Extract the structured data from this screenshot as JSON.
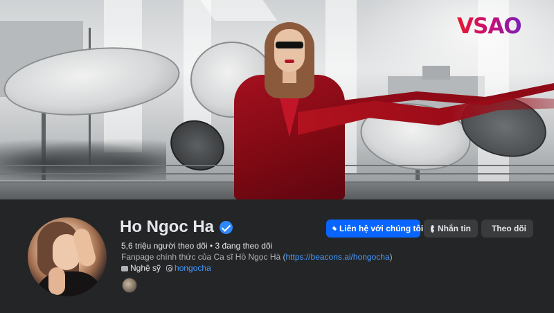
{
  "cover": {
    "brand_logo_text": "VSAO"
  },
  "profile": {
    "name": "Ho Ngoc Ha",
    "followers": "5,6 triệu người theo dõi",
    "following": "3 đang theo dõi",
    "bio_prefix": "Fanpage chính thức của Ca sĩ Hồ Ngọc Hà (",
    "bio_link": "https://beacons.ai/hongocha",
    "bio_suffix": ")",
    "category": "Nghệ sỹ",
    "instagram_handle": "hongocha"
  },
  "actions": {
    "contact_label": "Liên hệ với chúng tôi",
    "message_label": "Nhắn tin",
    "follow_label": "Theo dõi"
  },
  "icons": {
    "verified": "verified-badge-icon",
    "contact": "link-icon",
    "message": "messenger-icon",
    "follow": "follow-icon",
    "category": "briefcase-icon",
    "instagram": "instagram-icon"
  },
  "colors": {
    "background": "#242526",
    "primary_button": "#0866ff",
    "secondary_button": "#3a3b3c",
    "link": "#4599ff",
    "verified": "#2d88ff"
  }
}
